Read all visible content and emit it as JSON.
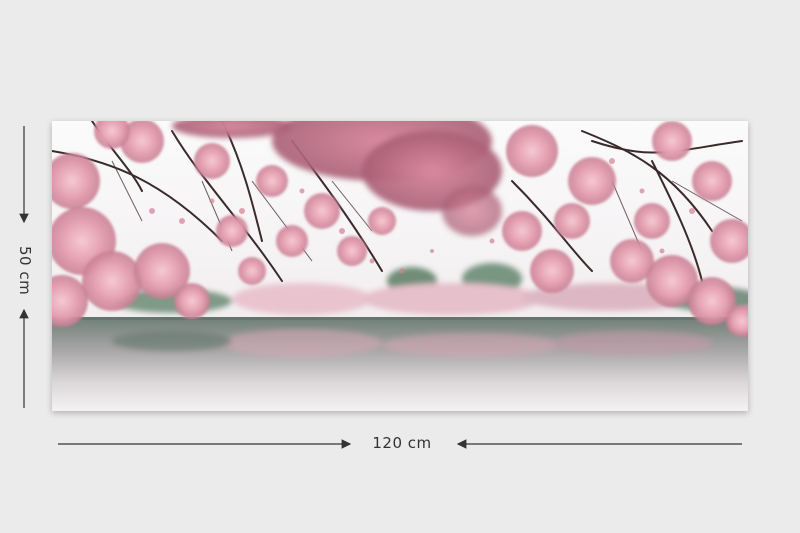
{
  "dimensions": {
    "height_label": "50 cm",
    "width_label": "120 cm"
  },
  "image": {
    "icon": "cherry-blossom-lake-photo"
  },
  "colors": {
    "background": "#ebebeb",
    "blossom": "#e8a3b4",
    "water": "#8e9c95"
  }
}
